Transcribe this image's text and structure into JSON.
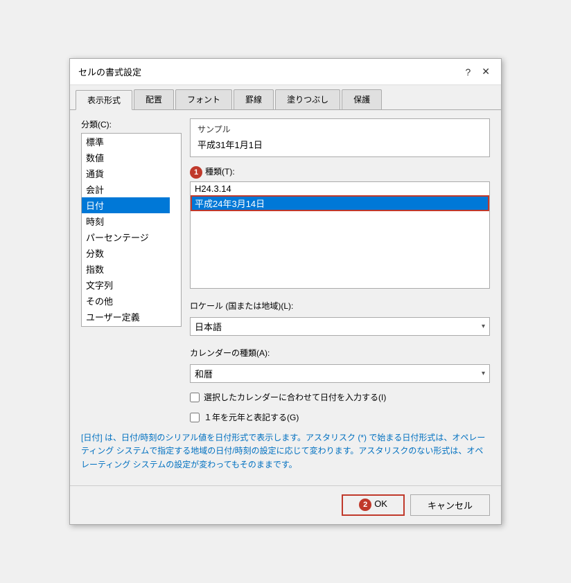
{
  "dialog": {
    "title": "セルの書式設定",
    "help_icon": "?",
    "close_icon": "✕"
  },
  "tabs": [
    {
      "label": "表示形式",
      "active": true
    },
    {
      "label": "配置",
      "active": false
    },
    {
      "label": "フォント",
      "active": false
    },
    {
      "label": "罫線",
      "active": false
    },
    {
      "label": "塗りつぶし",
      "active": false
    },
    {
      "label": "保護",
      "active": false
    }
  ],
  "category": {
    "label": "分類(C):",
    "items": [
      {
        "label": "標準"
      },
      {
        "label": "数値"
      },
      {
        "label": "通貨"
      },
      {
        "label": "会計"
      },
      {
        "label": "日付",
        "selected": true
      },
      {
        "label": "時刻"
      },
      {
        "label": "パーセンテージ"
      },
      {
        "label": "分数"
      },
      {
        "label": "指数"
      },
      {
        "label": "文字列"
      },
      {
        "label": "その他"
      },
      {
        "label": "ユーザー定義"
      }
    ]
  },
  "sample": {
    "label": "サンプル",
    "value": "平成31年1月1日"
  },
  "type": {
    "label": "種類(T):",
    "items": [
      {
        "label": "H24.3.14",
        "selected": false
      },
      {
        "label": "平成24年3月14日",
        "selected": true
      }
    ]
  },
  "locale": {
    "label": "ロケール (国または地域)(L):",
    "value": "日本語"
  },
  "calendar": {
    "label": "カレンダーの種類(A):",
    "value": "和暦"
  },
  "checkboxes": [
    {
      "label": "選択したカレンダーに合わせて日付を入力する(I)",
      "checked": false
    },
    {
      "label": "１年を元年と表記する(G)",
      "checked": false
    }
  ],
  "description": "[日付] は、日付/時刻のシリアル値を日付形式で表示します。アスタリスク (*) で始まる日付形式は、オペレーティング システムで指定する地域の日付/時刻の設定に応じて変わります。アスタリスクのない形式は、オペレーティング システムの設定が変わってもそのままです。",
  "footer": {
    "ok_label": "OK",
    "cancel_label": "キャンセル"
  },
  "badges": {
    "type_badge": "1",
    "ok_badge": "2"
  }
}
